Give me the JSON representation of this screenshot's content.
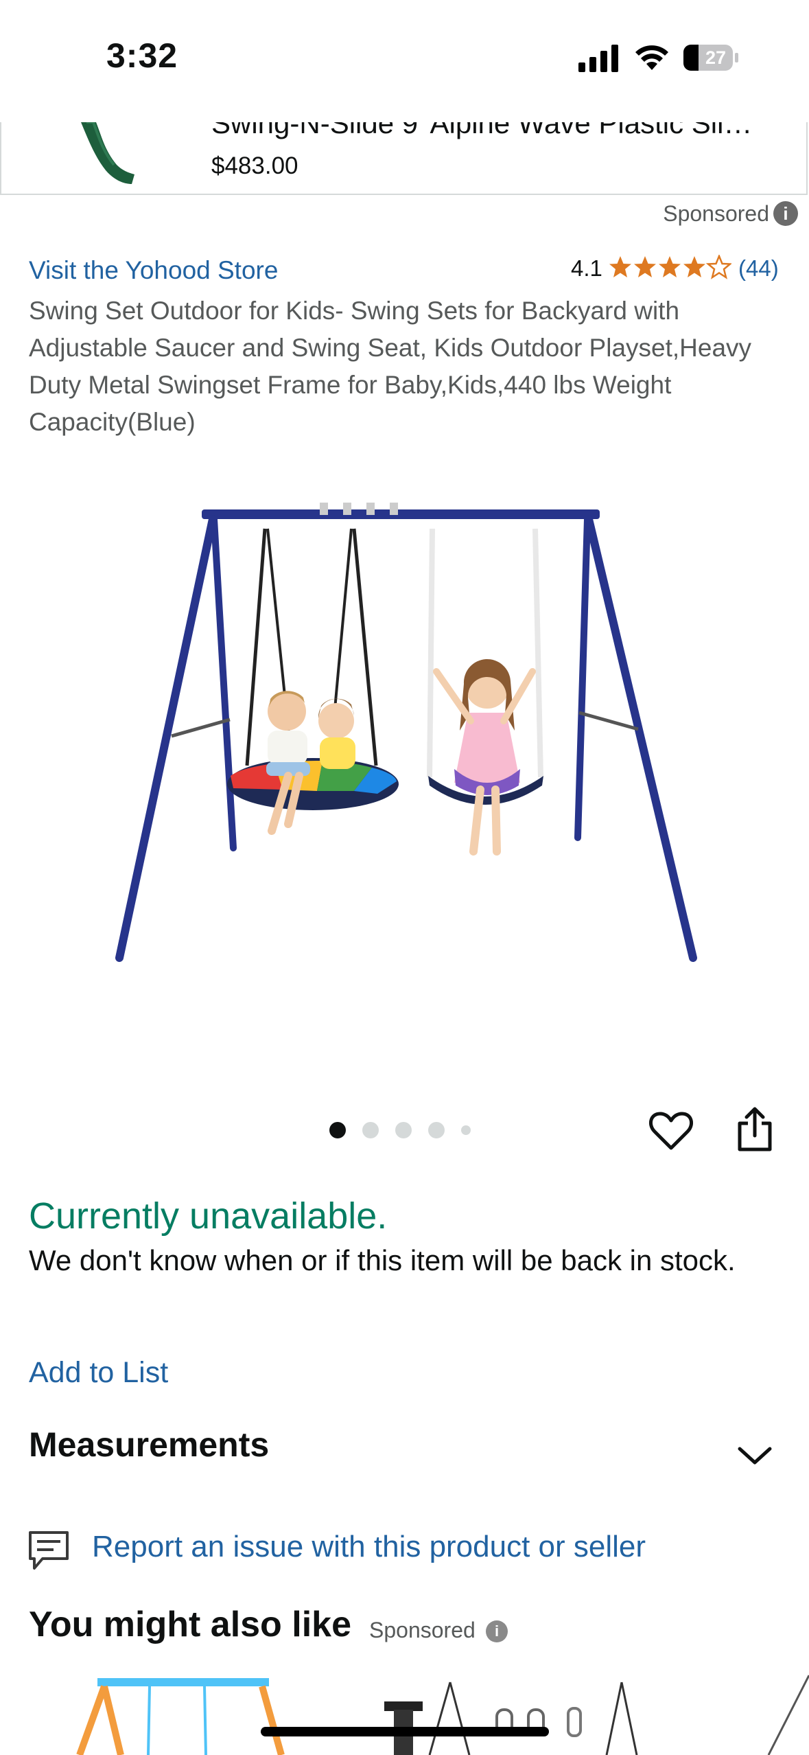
{
  "status_bar": {
    "time": "3:32",
    "battery": "27"
  },
  "sponsored_banner": {
    "title": "Swing-N-Slide 9' Alpine Wave Plastic Sli…",
    "price": "$483.00",
    "sponsored_label": "Sponsored",
    "info_glyph": "i"
  },
  "product": {
    "store_link": "Visit the Yohood Store",
    "rating_value": "4.1",
    "rating_stars": 4.1,
    "review_count": "(44)",
    "title": "Swing Set Outdoor for Kids- Swing Sets for Backyard with Adjustable Saucer and Swing Seat, Kids Outdoor Playset,Heavy Duty Metal Swingset Frame for Baby,Kids,440 lbs Weight Capacity(Blue)",
    "image_count": 5,
    "active_image": 1
  },
  "availability": {
    "status": "Currently unavailable.",
    "detail": "We don't know when or if this item will be back in stock."
  },
  "actions": {
    "add_to_list": "Add to List"
  },
  "measurements": {
    "title": "Measurements"
  },
  "report": {
    "link": "Report an issue with this product or seller"
  },
  "recommendations": {
    "title": "You might also like",
    "sponsored_label": "Sponsored",
    "info_glyph": "i"
  },
  "colors": {
    "link": "#2162a1",
    "available_green": "#067d62",
    "star": "#de7921",
    "text": "#0f1111",
    "secondary_text": "#565959"
  },
  "icons": {
    "signal": "cellular-signal-icon",
    "wifi": "wifi-icon",
    "battery": "battery-icon",
    "wishlist": "heart-icon",
    "share": "share-icon",
    "chevron": "chevron-down-icon",
    "report": "feedback-icon"
  }
}
